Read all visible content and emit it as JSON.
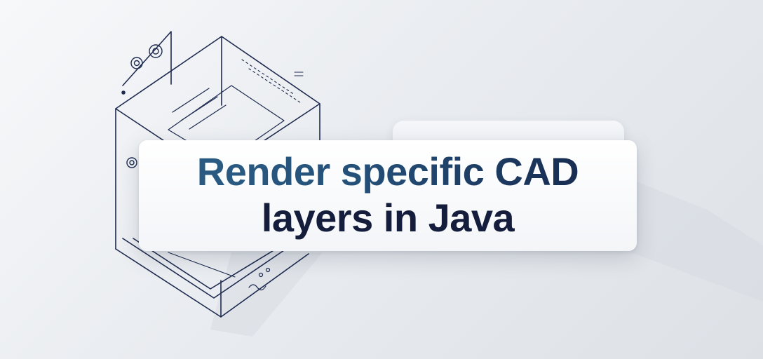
{
  "hero": {
    "title_line_1": "Render specific CAD",
    "title_line_2": "layers in Java"
  },
  "colors": {
    "background": "#eceff2",
    "line_art": "#1e2b4f",
    "title_accent": "#2d5f86",
    "title_dark": "#141d3c",
    "card": "#ffffff"
  },
  "icons": [
    "isometric-box-icon",
    "gear-icon"
  ]
}
